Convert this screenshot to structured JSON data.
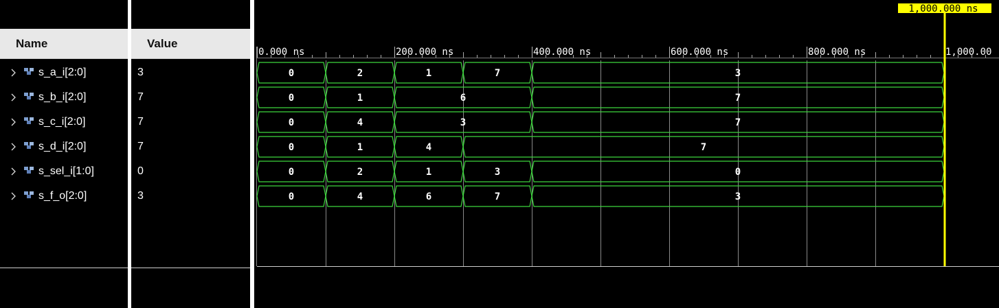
{
  "header": {
    "name_label": "Name",
    "value_label": "Value"
  },
  "cursor": {
    "label": "1,000.000 ns",
    "time": 1000
  },
  "timeline": {
    "ticks": [
      {
        "t": 0,
        "label": "0.000 ns"
      },
      {
        "t": 200,
        "label": "200.000 ns"
      },
      {
        "t": 400,
        "label": "400.000 ns"
      },
      {
        "t": 600,
        "label": "600.000 ns"
      },
      {
        "t": 800,
        "label": "800.000 ns"
      },
      {
        "t": 1000,
        "label": "1,000.00"
      }
    ]
  },
  "signals": [
    {
      "name": "s_a_i[2:0]",
      "value": "3",
      "segments": [
        {
          "t0": 0,
          "t1": 100,
          "v": "0"
        },
        {
          "t0": 100,
          "t1": 200,
          "v": "2"
        },
        {
          "t0": 200,
          "t1": 300,
          "v": "1"
        },
        {
          "t0": 300,
          "t1": 400,
          "v": "7"
        },
        {
          "t0": 400,
          "t1": 1000,
          "v": "3"
        }
      ]
    },
    {
      "name": "s_b_i[2:0]",
      "value": "7",
      "segments": [
        {
          "t0": 0,
          "t1": 100,
          "v": "0"
        },
        {
          "t0": 100,
          "t1": 200,
          "v": "1"
        },
        {
          "t0": 200,
          "t1": 400,
          "v": "6"
        },
        {
          "t0": 400,
          "t1": 1000,
          "v": "7"
        }
      ]
    },
    {
      "name": "s_c_i[2:0]",
      "value": "7",
      "segments": [
        {
          "t0": 0,
          "t1": 100,
          "v": "0"
        },
        {
          "t0": 100,
          "t1": 200,
          "v": "4"
        },
        {
          "t0": 200,
          "t1": 400,
          "v": "3"
        },
        {
          "t0": 400,
          "t1": 1000,
          "v": "7"
        }
      ]
    },
    {
      "name": "s_d_i[2:0]",
      "value": "7",
      "segments": [
        {
          "t0": 0,
          "t1": 100,
          "v": "0"
        },
        {
          "t0": 100,
          "t1": 200,
          "v": "1"
        },
        {
          "t0": 200,
          "t1": 300,
          "v": "4"
        },
        {
          "t0": 300,
          "t1": 1000,
          "v": "7"
        }
      ]
    },
    {
      "name": "s_sel_i[1:0]",
      "value": "0",
      "segments": [
        {
          "t0": 0,
          "t1": 100,
          "v": "0"
        },
        {
          "t0": 100,
          "t1": 200,
          "v": "2"
        },
        {
          "t0": 200,
          "t1": 300,
          "v": "1"
        },
        {
          "t0": 300,
          "t1": 400,
          "v": "3"
        },
        {
          "t0": 400,
          "t1": 1000,
          "v": "0"
        }
      ]
    },
    {
      "name": "s_f_o[2:0]",
      "value": "3",
      "segments": [
        {
          "t0": 0,
          "t1": 100,
          "v": "0"
        },
        {
          "t0": 100,
          "t1": 200,
          "v": "4"
        },
        {
          "t0": 200,
          "t1": 300,
          "v": "6"
        },
        {
          "t0": 300,
          "t1": 400,
          "v": "7"
        },
        {
          "t0": 400,
          "t1": 1000,
          "v": "3"
        }
      ]
    }
  ],
  "colors": {
    "waveform": "#3cd63c",
    "cursor": "#ffff00",
    "grid": "#8a8a8a",
    "background": "#000000"
  }
}
